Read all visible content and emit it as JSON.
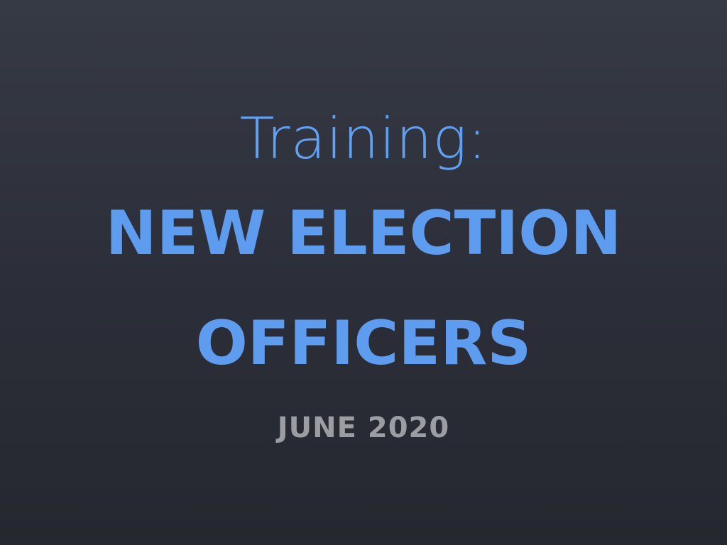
{
  "slide": {
    "subtitle": "Training:",
    "title_lines": [
      "NEW ELECTION",
      "OFFICERS"
    ],
    "date": "JUNE 2020"
  },
  "colors": {
    "background_top": "#363a45",
    "background_bottom": "#262830",
    "accent_blue": "#5e9cf0",
    "date_gray": "#9b9da2"
  }
}
